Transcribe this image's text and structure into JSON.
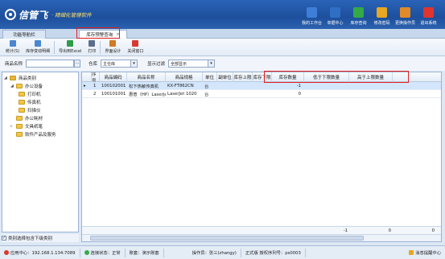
{
  "app": {
    "brand_name": "信管飞",
    "brand_sub": "精细化管理软件"
  },
  "top_toolbar": [
    {
      "label": "我的工作台",
      "icon": "monitor-icon",
      "color": "#3d7fd6"
    },
    {
      "label": "单据中心",
      "icon": "document-list-icon",
      "color": "#2f6fc4"
    },
    {
      "label": "库存查询",
      "icon": "inventory-icon",
      "color": "#35a948"
    },
    {
      "label": "修改密码",
      "icon": "lock-icon",
      "color": "#e6a722"
    },
    {
      "label": "更换操作员",
      "icon": "user-icon",
      "color": "#e08a2a"
    },
    {
      "label": "退出系统",
      "icon": "exit-icon",
      "color": "#e0352e"
    }
  ],
  "tabs": [
    {
      "label": "功能导航栏"
    },
    {
      "label": "库存预警查询",
      "close": "×"
    }
  ],
  "toolbar": [
    {
      "label": "统计(S)",
      "icon": "statistics-icon",
      "color": "#4b86cf"
    },
    {
      "label": "库存变动明细",
      "icon": "details-icon",
      "color": "#4b86cf"
    },
    {
      "label": "导出到Excel",
      "icon": "excel-icon",
      "color": "#2e9c48"
    },
    {
      "label": "打印",
      "icon": "print-icon",
      "color": "#5a6e8c"
    },
    {
      "label": "界面设计",
      "icon": "design-icon",
      "color": "#d07a26"
    },
    {
      "label": "关闭窗口",
      "icon": "close-window-icon",
      "color": "#d63a33"
    }
  ],
  "filter": {
    "product_name_label": "商品名称",
    "product_name_value": "",
    "lookup_button": "···",
    "warehouse_label": "仓库",
    "warehouse_value": "主仓库",
    "display_filter_label": "显示过滤",
    "display_filter_value": "全部显示",
    "dropdown_arrow": "▾"
  },
  "tree": {
    "root": "商品类别",
    "items": [
      {
        "label": "办公设备",
        "level": 1
      },
      {
        "label": "打印机",
        "level": 2
      },
      {
        "label": "传真机",
        "level": 2
      },
      {
        "label": "扫描仪",
        "level": 2
      },
      {
        "label": "办公耗材",
        "level": 1
      },
      {
        "label": "文具纸笔",
        "level": 1
      },
      {
        "label": "软件产品及服务",
        "level": 1
      }
    ],
    "include_sub_label": "类别选择包含下级类别",
    "include_sub_checked": "✓"
  },
  "table": {
    "columns": [
      "序号",
      "商品编码",
      "商品名称",
      "商品规格",
      "单位",
      "副单位",
      "库存上限",
      "库存下限",
      "库存数量",
      "低于下限数量",
      "高于上限数量"
    ],
    "rows": [
      {
        "marker": "▸",
        "no": "1",
        "code": "100102001",
        "name": "松下热敏传真机",
        "spec": "KX-FT862CN",
        "unit": "台",
        "sub_unit": "",
        "upper": "",
        "lower": "",
        "qty": "-1",
        "below": "",
        "above": ""
      },
      {
        "marker": "",
        "no": "2",
        "code": "100101001",
        "name": "惠普（HP）LaserJet",
        "spec": "LaserJet 1020",
        "unit": "台",
        "sub_unit": "",
        "upper": "",
        "lower": "",
        "qty": "0",
        "below": "",
        "above": ""
      }
    ],
    "totals": {
      "qty": "-1",
      "below": "0",
      "above": "0"
    }
  },
  "status": {
    "app_center": "应用中心：192.168.1.134:7089",
    "connection": "连接状态：正常",
    "account_set": "账套：演示账套",
    "operator": "操作员：张三(zhangy)",
    "version": "正式版 授权序列号：ps0003",
    "message": "消息提醒中心"
  }
}
